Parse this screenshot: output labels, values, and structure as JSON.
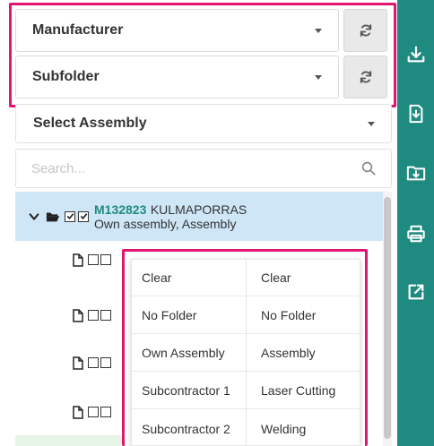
{
  "filters": {
    "manufacturer": {
      "label": "Manufacturer"
    },
    "subfolder": {
      "label": "Subfolder"
    }
  },
  "assembly_select": {
    "label": "Select Assembly"
  },
  "search": {
    "placeholder": "Search..."
  },
  "tree": {
    "selected": {
      "code": "M132823",
      "name": "KULMAPORRAS",
      "subtitle": "Own assembly, Assembly"
    }
  },
  "context_menu": {
    "left": [
      "Clear",
      "No Folder",
      "Own Assembly",
      "Subcontractor 1",
      "Subcontractor 2"
    ],
    "right": [
      "Clear",
      "No Folder",
      "Assembly",
      "Laser Cutting",
      "Welding"
    ]
  },
  "toolbar_icons": [
    "download-icon",
    "import-file-icon",
    "download-folder-icon",
    "print-icon",
    "external-link-icon"
  ],
  "colors": {
    "accent": "#1f8a80",
    "highlight": "#e2166e",
    "selected_row": "#cfe6f7"
  }
}
